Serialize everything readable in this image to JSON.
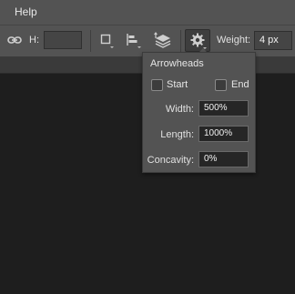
{
  "menubar": {
    "help_label": "Help"
  },
  "options_bar": {
    "height_label": "H:",
    "height_value": "",
    "weight_label": "Weight:",
    "weight_value": "4 px"
  },
  "arrowheads_popup": {
    "title": "Arrowheads",
    "start_label": "Start",
    "start_checked": false,
    "end_label": "End",
    "end_checked": false,
    "width_label": "Width:",
    "width_value": "500%",
    "length_label": "Length:",
    "length_value": "1000%",
    "concavity_label": "Concavity:",
    "concavity_value": "0%"
  },
  "icons": [
    "link-icon",
    "stroke-square-icon",
    "align-icon",
    "arrange-icon",
    "gear-icon"
  ]
}
